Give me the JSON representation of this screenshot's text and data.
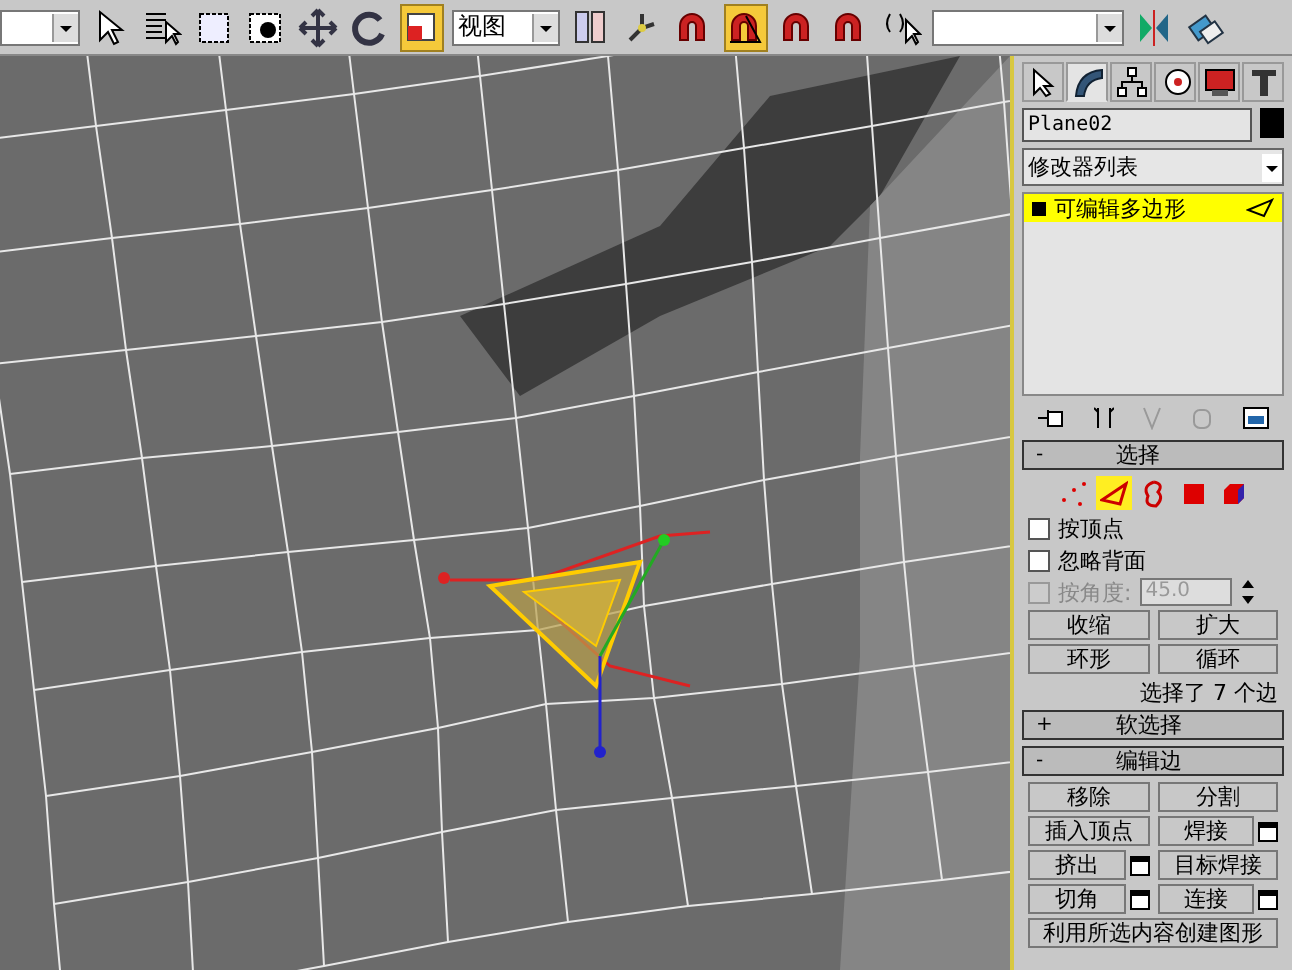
{
  "toolbar": {
    "items": [
      {
        "kind": "dropdown",
        "value": "",
        "wide": false
      },
      {
        "kind": "arrow",
        "selected": false
      },
      {
        "kind": "list",
        "selected": false
      },
      {
        "kind": "rect-select",
        "selected": false
      },
      {
        "kind": "circle-select",
        "selected": false
      },
      {
        "kind": "move",
        "selected": false
      },
      {
        "kind": "rotate",
        "selected": false
      },
      {
        "kind": "window",
        "selected": true
      },
      {
        "kind": "dropdown",
        "value": "视图",
        "wide": false
      },
      {
        "kind": "pivot",
        "selected": false
      },
      {
        "kind": "axis",
        "selected": false
      },
      {
        "kind": "snap",
        "selected": false
      },
      {
        "kind": "angle-snap",
        "selected": true
      },
      {
        "kind": "percent-snap",
        "selected": false
      },
      {
        "kind": "spinner-snap",
        "selected": false
      },
      {
        "kind": "named-select",
        "selected": false
      },
      {
        "kind": "dropdown",
        "value": "",
        "wide": true
      },
      {
        "kind": "mirror",
        "selected": false
      },
      {
        "kind": "align",
        "selected": false
      }
    ]
  },
  "panel": {
    "tabs": [
      {
        "kind": "create",
        "selected": false
      },
      {
        "kind": "modify",
        "selected": true
      },
      {
        "kind": "hierarchy",
        "selected": false
      },
      {
        "kind": "motion",
        "selected": false
      },
      {
        "kind": "display",
        "selected": false
      },
      {
        "kind": "utilities",
        "selected": false
      }
    ],
    "object_name": "Plane02",
    "modifier_list": "修改器列表",
    "stack": [
      {
        "label": "可编辑多边形",
        "selected": true
      }
    ],
    "rollouts": [
      {
        "kind": "selection",
        "toggle": "-",
        "title": "选择",
        "levels": [
          {
            "kind": "vertex",
            "selected": false
          },
          {
            "kind": "edge",
            "selected": true
          },
          {
            "kind": "border",
            "selected": false
          },
          {
            "kind": "polygon",
            "selected": false
          },
          {
            "kind": "element",
            "selected": false
          }
        ],
        "checks": [
          {
            "label": "按顶点",
            "checked": false,
            "disabled": false
          },
          {
            "label": "忽略背面",
            "checked": false,
            "disabled": false
          },
          {
            "label": "按角度:",
            "checked": false,
            "disabled": true,
            "value": "45.0"
          }
        ],
        "buttons": [
          "收缩",
          "扩大",
          "环形",
          "循环"
        ],
        "status": "选择了 7 个边"
      },
      {
        "kind": "collapsed",
        "toggle": "+",
        "title": "软选择"
      },
      {
        "kind": "edit-edges",
        "toggle": "-",
        "title": "编辑边",
        "buttons": [
          {
            "label": "移除",
            "settings": false
          },
          {
            "label": "分割",
            "settings": false
          },
          {
            "label": "插入顶点",
            "settings": false
          },
          {
            "label": "焊接",
            "settings": true
          },
          {
            "label": "挤出",
            "settings": true
          },
          {
            "label": "目标焊接",
            "settings": false
          },
          {
            "label": "切角",
            "settings": true
          },
          {
            "label": "连接",
            "settings": true
          }
        ],
        "wide_button": "利用所选内容创建图形"
      }
    ]
  }
}
